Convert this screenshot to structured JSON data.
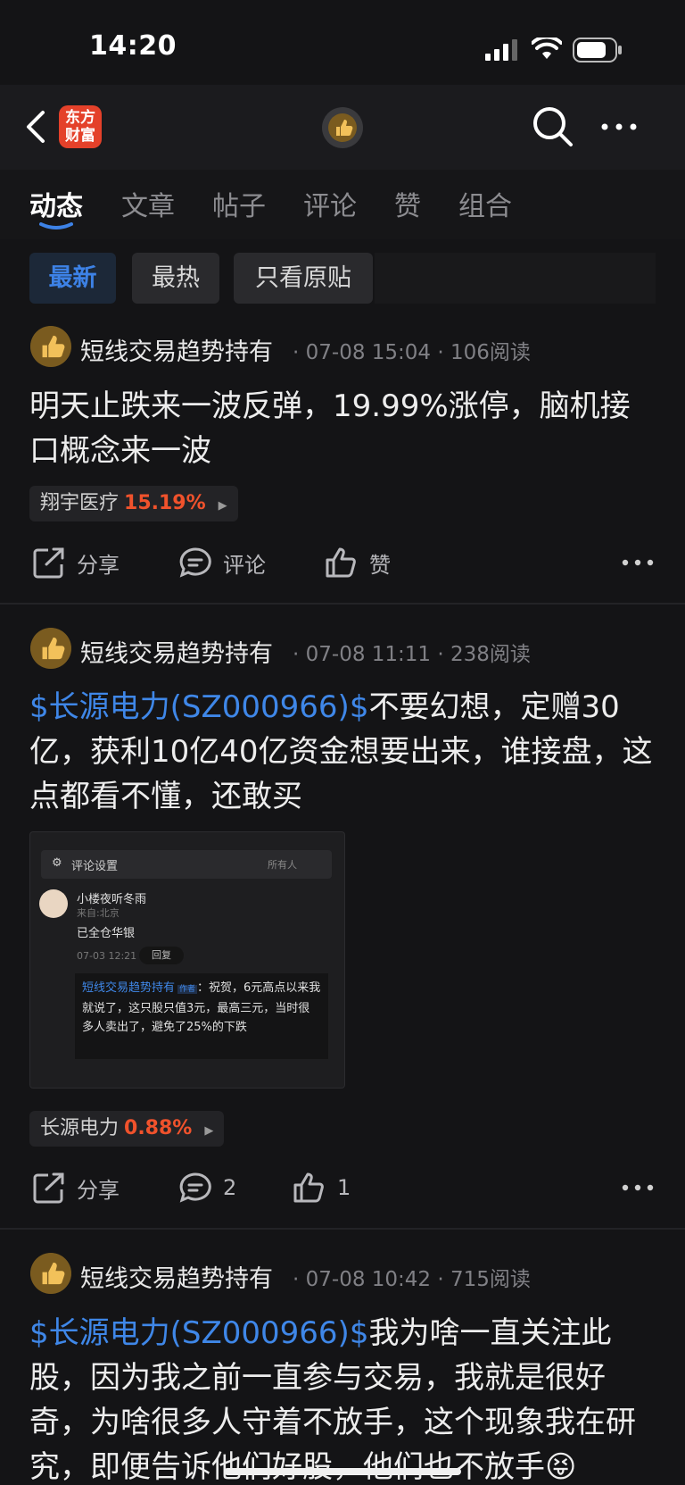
{
  "status_bar": {
    "time": "14:20"
  },
  "header": {
    "logo_text_1": "东方",
    "logo_text_2": "财富"
  },
  "tabs": [
    {
      "label": "动态"
    },
    {
      "label": "文章"
    },
    {
      "label": "帖子"
    },
    {
      "label": "评论"
    },
    {
      "label": "赞"
    },
    {
      "label": "组合"
    }
  ],
  "filters": {
    "latest": "最新",
    "hot": "最热",
    "original": "只看原贴"
  },
  "posts": [
    {
      "author": "短线交易趋势持有",
      "meta": "· 07-08 15:04 · 106阅读",
      "text": "明天止跌来一波反弹，19.99%涨停，脑机接口概念来一波",
      "stock_name": "翔宇医疗",
      "stock_pct": "15.19%",
      "share": "分享",
      "comment": "评论",
      "like": "赞"
    },
    {
      "author": "短线交易趋势持有",
      "meta": "· 07-08 11:11 · 238阅读",
      "link": "$长源电力(SZ000966)$",
      "text": "不要幻想，定赠30亿，获利10亿40亿资金想要出来，谁接盘，这点都看不懂，还敢买",
      "stock_name": "长源电力",
      "stock_pct": "0.88%",
      "share": "分享",
      "comment": "2",
      "like": "1",
      "embed": {
        "settings_label": "评论设置",
        "settings_value": "所有人",
        "commenter": "小楼夜听冬雨",
        "location": "来自:北京",
        "comment": "已全仓华银",
        "date": "07-03 12:21",
        "reply": "回复",
        "reply_author": "短线交易趋势持有",
        "reply_badge": "作者",
        "reply_text": "：祝贺，6元高点以来我就说了，这只股只值3元，最高三元，当时很多人卖出了，避免了25%的下跌"
      }
    },
    {
      "author": "短线交易趋势持有",
      "meta": "· 07-08 10:42 · 715阅读",
      "link": "$长源电力(SZ000966)$",
      "text": "我为啥一直关注此股，因为我之前一直参与交易，我就是很好奇，为啥很多人守着不放手，这个现象我在研究，即便告诉他们好股，他们也不放手😝"
    }
  ]
}
